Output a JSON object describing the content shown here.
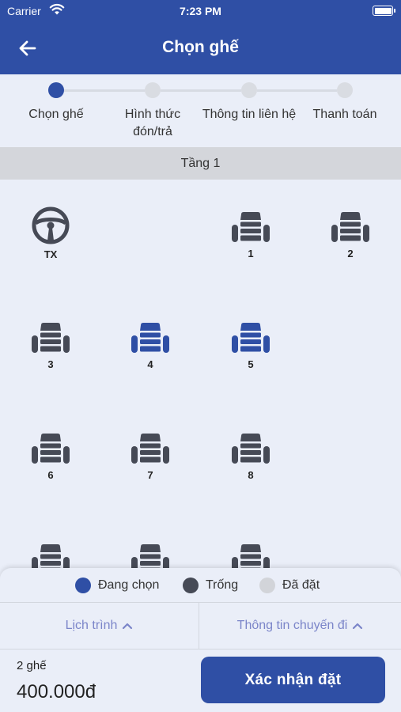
{
  "status_bar": {
    "carrier": "Carrier",
    "time": "7:23 PM"
  },
  "header": {
    "title": "Chọn ghế",
    "back_icon": "arrow-left-icon"
  },
  "stepper": {
    "steps": [
      {
        "label": "Chọn ghế",
        "active": true
      },
      {
        "label": "Hình thức đón/trả",
        "active": false
      },
      {
        "label": "Thông tin liên hệ",
        "active": false
      },
      {
        "label": "Thanh toán",
        "active": false
      }
    ]
  },
  "floor": {
    "label": "Tầng 1"
  },
  "seats": {
    "driver_label": "TX",
    "items": [
      {
        "number": "1",
        "status": "empty"
      },
      {
        "number": "2",
        "status": "empty"
      },
      {
        "number": "3",
        "status": "empty"
      },
      {
        "number": "4",
        "status": "selected"
      },
      {
        "number": "5",
        "status": "selected"
      },
      {
        "number": "6",
        "status": "empty"
      },
      {
        "number": "7",
        "status": "empty"
      },
      {
        "number": "8",
        "status": "empty"
      },
      {
        "number": "",
        "status": "empty"
      },
      {
        "number": "",
        "status": "empty"
      },
      {
        "number": "",
        "status": "empty"
      }
    ]
  },
  "legend": {
    "selected": "Đang chọn",
    "empty": "Trống",
    "booked": "Đã đặt"
  },
  "colors": {
    "primary": "#2f4fa5",
    "seat_empty": "#464a56",
    "seat_booked": "#d2d4d9",
    "tab_text": "#7b85c9"
  },
  "tabs": {
    "schedule": "Lịch trình",
    "trip_info": "Thông tin chuyến đi"
  },
  "summary": {
    "seat_count": "2 ghế",
    "total": "400.000đ",
    "confirm_label": "Xác nhận đặt"
  }
}
